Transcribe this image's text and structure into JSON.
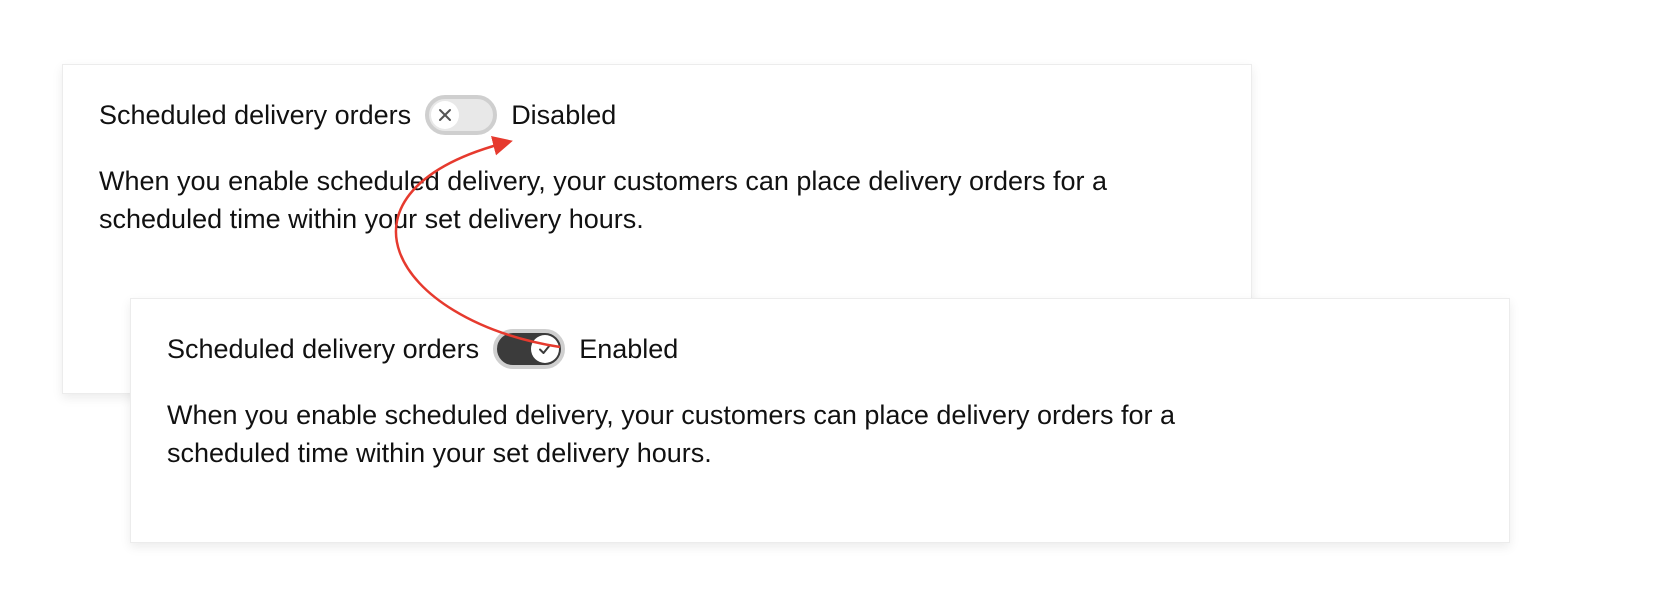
{
  "disabled_card": {
    "title": "Scheduled delivery orders",
    "state_label": "Disabled",
    "description": "When you enable scheduled delivery, your customers can place delivery orders for a scheduled time within your set delivery hours."
  },
  "enabled_card": {
    "title": "Scheduled delivery orders",
    "state_label": "Enabled",
    "description": "When you enable scheduled delivery, your customers can place delivery orders for a scheduled time within your set delivery hours."
  },
  "annotation": {
    "arrow_color": "#e63a2e"
  }
}
